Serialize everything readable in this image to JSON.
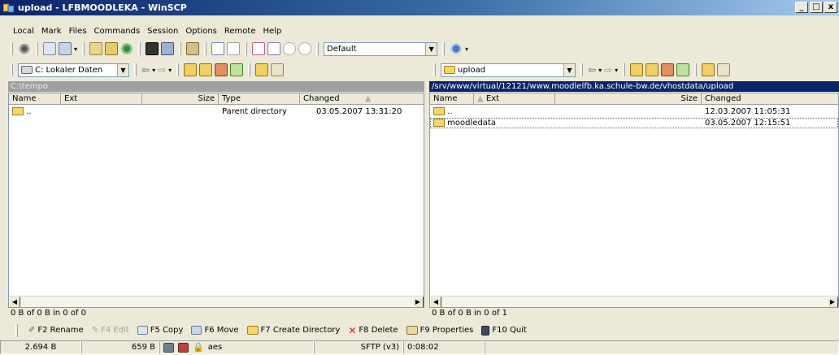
{
  "window": {
    "title": "upload - LFBMOODLEKA - WinSCP",
    "min": "_",
    "max": "□",
    "close": "x"
  },
  "menu": [
    "Local",
    "Mark",
    "Files",
    "Commands",
    "Session",
    "Options",
    "Remote",
    "Help"
  ],
  "toolbar": {
    "profile": "Default"
  },
  "local": {
    "drive": "C: Lokaler Daten",
    "path": "C:\\tempo",
    "columns": {
      "name": "Name",
      "ext": "Ext",
      "size": "Size",
      "type": "Type",
      "changed": "Changed"
    },
    "rows": [
      {
        "name": "..",
        "type": "Parent directory",
        "changed": "03.05.2007  13:31:20"
      }
    ],
    "status": "0 B of 0 B in 0 of 0"
  },
  "remote": {
    "dir": "upload",
    "path": "/srv/www/virtual/12121/www.moodlelfb.ka.schule-bw.de/vhostdata/upload",
    "columns": {
      "name": "Name",
      "ext": "Ext",
      "size": "Size",
      "changed": "Changed"
    },
    "rows": [
      {
        "name": "..",
        "changed": "12.03.2007  11:05:31"
      },
      {
        "name": "moodledata",
        "changed": "03.05.2007  12:15:51"
      }
    ],
    "status": "0 B of 0 B in 0 of 1"
  },
  "fkeys": {
    "rename": "F2 Rename",
    "edit": "F4 Edit",
    "copy": "F5 Copy",
    "move": "F6 Move",
    "mkdir": "F7 Create Directory",
    "delete": "F8 Delete",
    "properties": "F9 Properties",
    "quit": "F10 Quit"
  },
  "statusbar": {
    "sent": "2.694 B",
    "received": "659 B",
    "cipher": "aes",
    "protocol": "SFTP (v3)",
    "time": "0:08:02"
  },
  "icons": [
    "winscp-app-icon",
    "folder-up-icon",
    "folder-icon",
    "back-arrow-icon",
    "forward-arrow-icon",
    "home-icon",
    "refresh-icon",
    "rename-icon",
    "copy-icon",
    "move-icon",
    "delete-icon",
    "properties-icon",
    "quit-icon",
    "lock-icon"
  ]
}
